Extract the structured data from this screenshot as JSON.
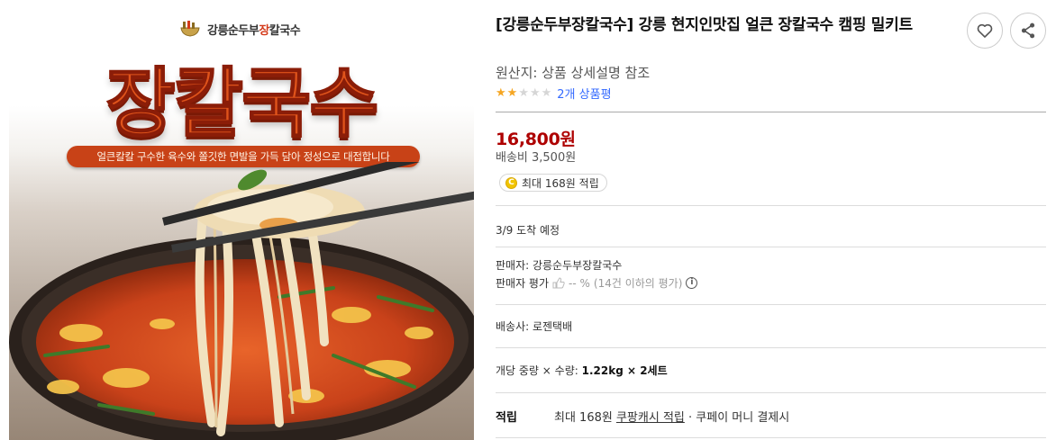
{
  "image": {
    "brand_prefix": "강릉순두부",
    "brand_highlight": "장",
    "brand_suffix": "칼국수",
    "hero_title": "장칼국수",
    "tagline": "얼큰칼칼 구수한 육수와 쫄깃한 면발을 가득 담아 정성으로 대접합니다"
  },
  "product": {
    "title": "[강릉순두부장칼국수] 강릉 현지인맛집 얼큰 장칼국수 캠핑 밀키트",
    "origin": "원산지: 상품 상세설명 참조",
    "rating": {
      "value": 2,
      "max": 5,
      "review_count": "2개 상품평"
    },
    "price": "16,800원",
    "shipping_fee": "배송비 3,500원",
    "reward_badge": "최대 168원 적립",
    "coin_icon": "C",
    "delivery_date": "3/9 도착 예정",
    "seller": "판매자: 강릉순두부장칼국수",
    "seller_rating_label": "판매자 평가",
    "seller_rating_value": "-- %",
    "seller_rating_note": "(14건 이하의 평가)",
    "info_icon": "i",
    "courier": "배송사: 로젠택배",
    "option_label": "개당 중량 × 수량: ",
    "option_value": "1.22kg × 2세트",
    "reward_label": "적립",
    "reward_detail_prefix": "최대 168원 ",
    "reward_detail_link": "쿠팡캐시 적립",
    "reward_detail_suffix": " · 쿠페이 머니 결제시"
  },
  "icons": {
    "wish": "heart-icon",
    "share": "share-icon",
    "thumb": "thumbs-up-icon"
  },
  "colors": {
    "price": "#ae0000",
    "link": "#346aff",
    "star": "#f5a623",
    "hero": "#e0541b"
  }
}
